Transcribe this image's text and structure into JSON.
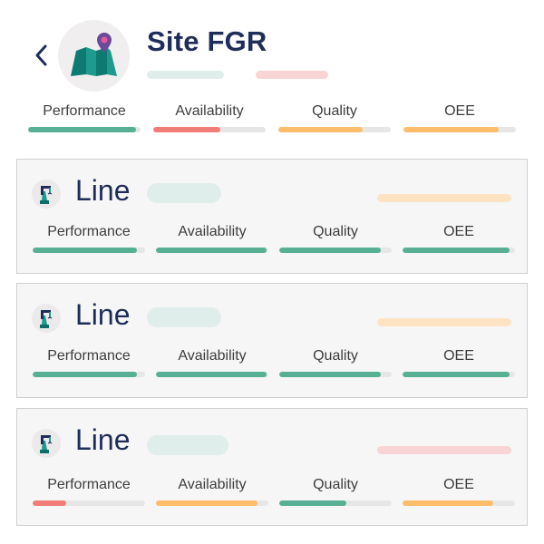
{
  "header": {
    "back_icon": "chevron-left-icon",
    "site_icon": "map-pin-icon",
    "title": "Site FGR",
    "status_pills": [
      {
        "color": "#dfeeea"
      },
      {
        "color": "#f9d4d4"
      }
    ]
  },
  "site_metrics": [
    {
      "label": "Performance",
      "value": 0.96,
      "color": "#57b094"
    },
    {
      "label": "Availability",
      "value": 0.6,
      "color": "#f07e77"
    },
    {
      "label": "Quality",
      "value": 0.75,
      "color": "#fdbd6a"
    },
    {
      "label": "OEE",
      "value": 0.85,
      "color": "#fdbd6a"
    }
  ],
  "lines": [
    {
      "title": "Line",
      "icon": "robot-arm-icon",
      "tag_color": "#dfeeea",
      "status_color": "#fde3c2",
      "metrics": [
        {
          "label": "Performance",
          "value": 0.93,
          "color": "#57b094"
        },
        {
          "label": "Availability",
          "value": 0.98,
          "color": "#57b094"
        },
        {
          "label": "Quality",
          "value": 0.9,
          "color": "#57b094"
        },
        {
          "label": "OEE",
          "value": 0.95,
          "color": "#57b094"
        }
      ]
    },
    {
      "title": "Line",
      "icon": "robot-arm-icon",
      "tag_color": "#dfeeea",
      "status_color": "#fde3c2",
      "metrics": [
        {
          "label": "Performance",
          "value": 0.93,
          "color": "#57b094"
        },
        {
          "label": "Availability",
          "value": 0.98,
          "color": "#57b094"
        },
        {
          "label": "Quality",
          "value": 0.9,
          "color": "#57b094"
        },
        {
          "label": "OEE",
          "value": 0.95,
          "color": "#57b094"
        }
      ]
    },
    {
      "title": "Line",
      "icon": "robot-arm-icon",
      "tag_color": "#dfeeea",
      "status_color": "#f9d4d4",
      "metrics": [
        {
          "label": "Performance",
          "value": 0.3,
          "color": "#f07e77"
        },
        {
          "label": "Availability",
          "value": 0.9,
          "color": "#fdbd6a"
        },
        {
          "label": "Quality",
          "value": 0.6,
          "color": "#57b094"
        },
        {
          "label": "OEE",
          "value": 0.81,
          "color": "#fdbd6a"
        }
      ]
    }
  ]
}
